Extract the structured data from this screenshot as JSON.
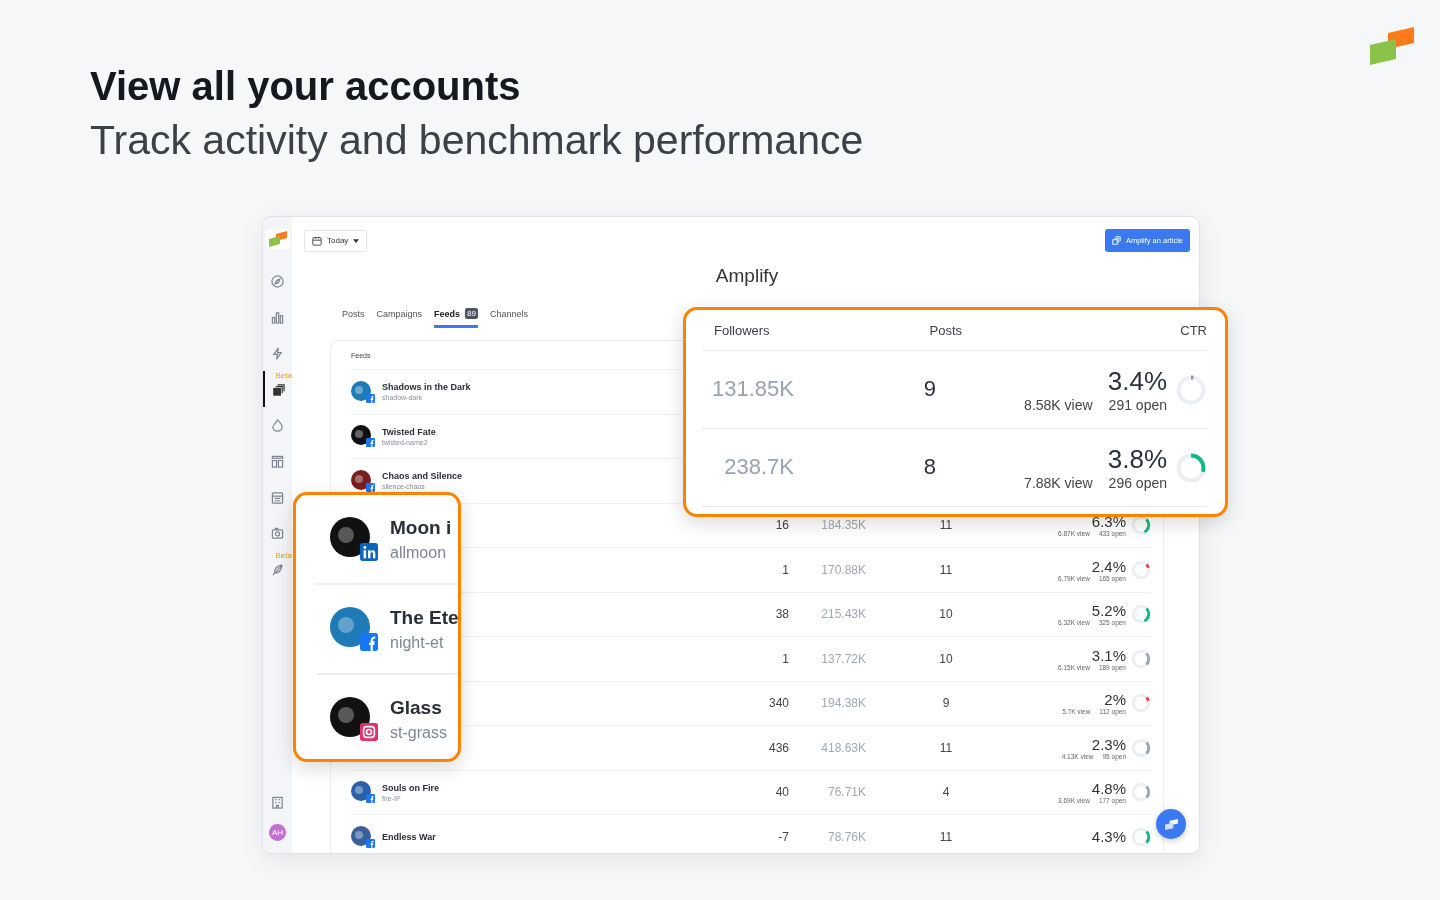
{
  "heading": {
    "title": "View all your accounts",
    "subtitle": "Track activity and benchmark performance"
  },
  "app": {
    "sidebar": {
      "items": [
        {
          "selected": false
        },
        {
          "selected": false
        },
        {
          "selected": false
        },
        {
          "selected": true,
          "badge": "Beta"
        },
        {
          "selected": false
        },
        {
          "selected": false
        },
        {
          "selected": false
        },
        {
          "selected": false
        },
        {
          "selected": false,
          "badge": "Beta"
        }
      ],
      "footer_items": [
        {
          "selected": false
        }
      ],
      "avatar": "AH"
    },
    "date_filter": "Today",
    "action_button": "Amplify an article",
    "title": "Amplify",
    "tabs": [
      {
        "label": "Posts",
        "selected": false
      },
      {
        "label": "Campaigns",
        "selected": false
      },
      {
        "label": "Feeds",
        "selected": true,
        "count": "89"
      },
      {
        "label": "Channels",
        "selected": false
      }
    ],
    "table": {
      "column_1": "Feeds",
      "rows": [
        {
          "name": "Shadows in the Dark",
          "handle": "shadow-dark",
          "color": "#1f7ab8",
          "kind": "facebook"
        },
        {
          "name": "Twisted Fate",
          "handle": "twisted-name2",
          "color": "#111111",
          "kind": "facebook"
        },
        {
          "name": "Chaos and Silence",
          "handle": "silence-chaos",
          "color": "#7a1f1f",
          "kind": "facebook"
        },
        {
          "column_2": "16",
          "followers": "184.35K",
          "posts": "11",
          "ctr": {
            "value": "6.3%",
            "views": "6.87K view",
            "opens": "433 open",
            "level": 0.3,
            "color": "#10b981"
          }
        },
        {
          "column_2": "1",
          "followers": "170.88K",
          "posts": "11",
          "ctr": {
            "value": "2.4%",
            "views": "6.79K view",
            "opens": "165 open",
            "level": 0.08,
            "color": "#ef4444"
          }
        },
        {
          "column_2": "38",
          "followers": "215.43K",
          "posts": "10",
          "ctr": {
            "value": "5.2%",
            "views": "6.32K view",
            "opens": "325 open",
            "level": 0.3,
            "color": "#10b981"
          }
        },
        {
          "column_2": "1",
          "followers": "137.72K",
          "posts": "10",
          "ctr": {
            "value": "3.1%",
            "views": "6.15K view",
            "opens": "189 open",
            "level": 0.25,
            "color": "#9aa3b5"
          }
        },
        {
          "column_2": "340",
          "followers": "194.38K",
          "posts": "9",
          "ctr": {
            "value": "2%",
            "views": "5.7K view",
            "opens": "112 open",
            "level": 0.08,
            "color": "#ef4444"
          }
        },
        {
          "column_2": "436",
          "followers": "418.63K",
          "posts": "11",
          "ctr": {
            "value": "2.3%",
            "views": "4.13K view",
            "opens": "95 open",
            "level": 0.25,
            "color": "#9aa3b5"
          }
        },
        {
          "name": "Souls on Fire",
          "handle": "fire-IP",
          "color": "#2b5fa8",
          "kind": "facebook",
          "column_2": "40",
          "followers": "76.71K",
          "posts": "4",
          "ctr": {
            "value": "4.8%",
            "views": "3.69K view",
            "opens": "177 open",
            "level": 0.25,
            "color": "#9aa3b5"
          }
        },
        {
          "name": "Endless War",
          "color": "#3b5f9a",
          "kind": "facebook",
          "column_2": "-7",
          "followers": "78.76K",
          "posts": "11",
          "ctr": {
            "value": "4.3%",
            "level": 0.25,
            "color": "#10b981"
          }
        }
      ]
    }
  },
  "zoom_stats": {
    "columns": [
      "Followers",
      "Posts",
      "CTR"
    ],
    "rows": [
      {
        "followers": "131.85K",
        "posts": "9",
        "ctr": "3.4%",
        "views": "8.58K view",
        "opens": "291 open",
        "level": 0.03,
        "color": "#8b95a7"
      },
      {
        "followers": "238.7K",
        "posts": "8",
        "ctr": "3.8%",
        "views": "7.88K view",
        "opens": "296 open",
        "level": 0.3,
        "color": "#10b981"
      }
    ]
  },
  "zoom_feeds": [
    {
      "name": "Moon i",
      "handle": "allmoon",
      "color": "#111111",
      "kind": "linkedin"
    },
    {
      "name": "The Ete",
      "handle": "night-et",
      "color": "#1f7ab8",
      "kind": "facebook"
    },
    {
      "name": "Glass",
      "handle": "st-grass",
      "color": "#111111",
      "kind": "instagram"
    }
  ]
}
